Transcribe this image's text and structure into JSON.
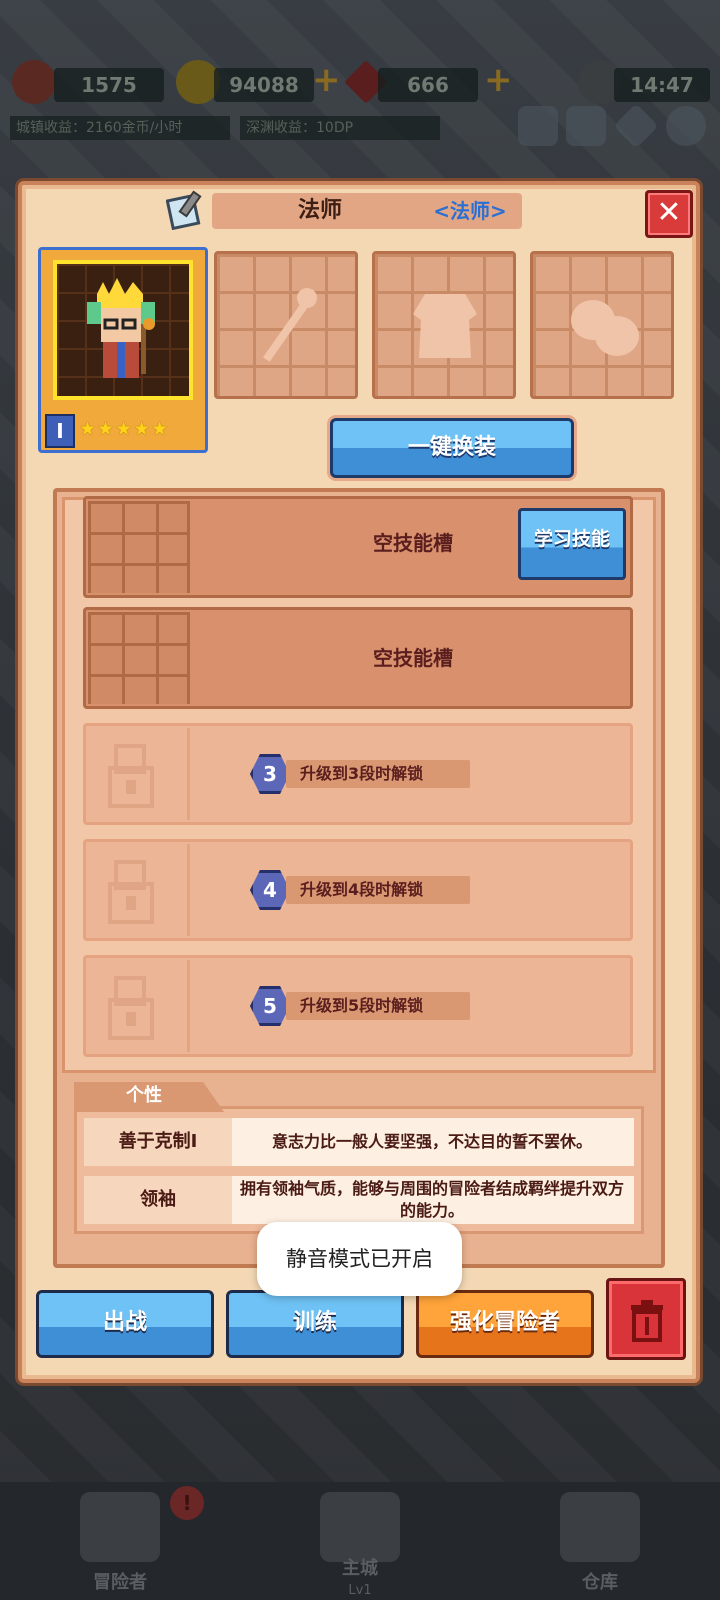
{
  "hud": {
    "energy": "1575",
    "gold": "94088",
    "gems": "666",
    "clock": "14:47",
    "town_income": "城镇收益：2160金币/小时",
    "abyss_income": "深渊收益：10DP"
  },
  "dialog": {
    "title": "法师",
    "class_tag": "<法师>",
    "close_label": "✕",
    "hero": {
      "level": "I",
      "stars": 5,
      "stars_text": "★★★★★"
    },
    "swap_button": "一键换装",
    "skills": {
      "learn_button": "学习技能",
      "empty_slot_1": "空技能槽",
      "empty_slot_2": "空技能槽",
      "locked": [
        {
          "stage": "3",
          "text": "升级到3段时解锁"
        },
        {
          "stage": "4",
          "text": "升级到4段时解锁"
        },
        {
          "stage": "5",
          "text": "升级到5段时解锁"
        }
      ]
    },
    "personality": {
      "tab": "个性",
      "traits": [
        {
          "name": "善于克制I",
          "desc": "意志力比一般人要坚强，不达目的誓不罢休。"
        },
        {
          "name": "领袖",
          "desc": "拥有领袖气质，能够与周围的冒险者结成羁绊提升双方的能力。"
        }
      ]
    },
    "buttons": {
      "battle": "出战",
      "train": "训练",
      "enhance": "强化冒险者"
    }
  },
  "toast": "静音模式已开启",
  "nav": {
    "adventurer": "冒险者",
    "alert": "!",
    "main_city": "主城",
    "main_city_level": "Lv1",
    "warehouse": "仓库"
  },
  "colors": {
    "accent_blue": "#3f8fd6",
    "danger_red": "#d8343a",
    "enhance_orange": "#ffa43a",
    "panel_bg": "#f3d8b3"
  }
}
